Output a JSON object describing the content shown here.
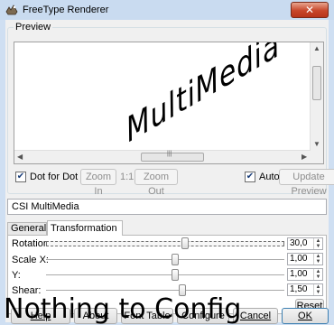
{
  "window": {
    "title": "FreeType Renderer",
    "close_label": "✕"
  },
  "preview": {
    "group_label": "Preview",
    "sample_text": "MultiMedia",
    "scroll_mid_marker": "|||"
  },
  "toolbar": {
    "dot_for_dot_label": "Dot for Dot",
    "dot_for_dot_checked": true,
    "zoom_in_label": "Zoom In",
    "zoom_ratio_label": "1:1",
    "zoom_out_label": "Zoom Out",
    "auto_label": "Auto",
    "auto_checked": true,
    "update_preview_label": "Update Preview"
  },
  "font_field": {
    "value": "CSI MultiMedia"
  },
  "tabs": [
    {
      "label": "General",
      "active": false
    },
    {
      "label": "Transformation",
      "active": true
    }
  ],
  "transformation": {
    "rotation": {
      "label": "Rotation:",
      "value": "30,0"
    },
    "scale_x": {
      "label": "Scale X:",
      "value": "1,00"
    },
    "y": {
      "label": "Y:",
      "value": "1,00"
    },
    "shear": {
      "label": "Shear:",
      "value": "1,50"
    },
    "reset_label": "Reset"
  },
  "buttons": {
    "help": "Help",
    "about": "About",
    "font_table": "Font Table",
    "configure": "Configure",
    "cancel": "Cancel",
    "ok": "OK"
  },
  "overlay": {
    "text": "Nothing to Config"
  },
  "colors": {
    "titlebar": "#c9dbf0",
    "client": "#f0f0f0",
    "close": "#c7462a"
  }
}
